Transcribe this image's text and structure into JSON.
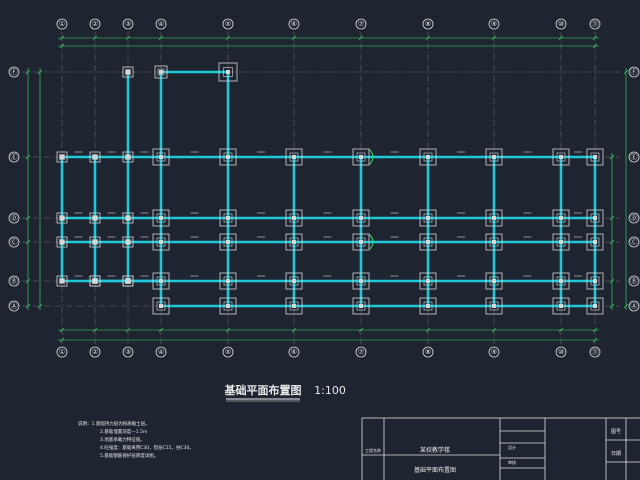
{
  "drawing": {
    "title": "基础平面布置图",
    "scale": "1:100",
    "grid_columns": [
      "①",
      "②",
      "③",
      "④",
      "⑤",
      "⑥",
      "⑦",
      "⑧",
      "⑨",
      "⑩",
      "⑪"
    ],
    "grid_rows": [
      "Ⓐ",
      "Ⓑ",
      "Ⓒ",
      "Ⓓ",
      "Ⓔ",
      "Ⓕ"
    ],
    "notes": [
      "说明：1.基础持力层为粉质黏土层。",
      "2.基础埋置深度—1.5m",
      "3.地基承载力特征值。",
      "4.砼强度：基础采用C30，垫层C15，柱C30。",
      "5.基础钢筋保护层厚度详图。"
    ]
  },
  "title_block": {
    "project_label": "工程名称",
    "project_name": "某校教学楼",
    "drawing_name": "基础平面布置图",
    "sheet_label": "图号",
    "date_label": "日期",
    "designer_label": "设计",
    "reviewer_label": "审核"
  },
  "colors": {
    "background": "#1e2430",
    "beam": "#1fc8d8",
    "grid_line": "#b0b0b0",
    "dimension": "#39e06a",
    "footing": "#d6d6d6",
    "text": "#e8e8e8"
  }
}
